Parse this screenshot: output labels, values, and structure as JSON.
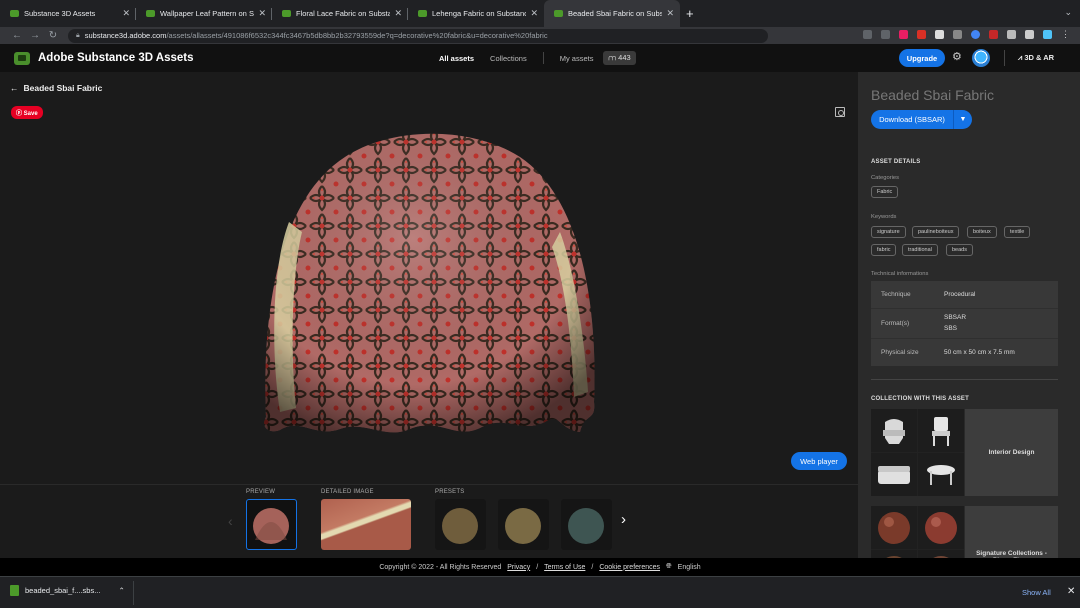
{
  "browser": {
    "tabs": [
      {
        "title": "Substance 3D Assets",
        "active": false
      },
      {
        "title": "Wallpaper Leaf Pattern on Sub",
        "active": false
      },
      {
        "title": "Floral Lace Fabric on Substanc",
        "active": false
      },
      {
        "title": "Lehenga Fabric on Substance",
        "active": false
      },
      {
        "title": "Beaded Sbai Fabric on Substa",
        "active": true
      }
    ],
    "new_tab": "+",
    "url_host": "substance3d.adobe.com",
    "url_path": "/assets/allassets/491086f6532c344fc3467b5db8bb2b32793559de?q=decorative%20fabric&u=decorative%20fabric"
  },
  "app": {
    "title": "Adobe Substance 3D Assets",
    "nav": {
      "all_assets": "All assets",
      "collections": "Collections",
      "my_assets": "My assets",
      "count": "443"
    },
    "upgrade": "Upgrade",
    "ar_link": "3D & AR"
  },
  "viewer": {
    "back_title": "Beaded Sbai Fabric",
    "save": "Save",
    "web_player": "Web player",
    "labels": {
      "preview": "PREVIEW",
      "detailed": "DETAILED IMAGE",
      "presets": "PRESETS"
    }
  },
  "panel": {
    "title": "Beaded Sbai Fabric",
    "download": "Download (SBSAR)",
    "asset_details": "ASSET DETAILS",
    "categories_label": "Categories",
    "categories": [
      "Fabric"
    ],
    "keywords_label": "Keywords",
    "keywords": [
      "signature",
      "paulineboiteux",
      "boiteux",
      "textile",
      "fabric",
      "traditional",
      "beads"
    ],
    "tech_label": "Technical informations",
    "technique_k": "Technique",
    "technique_v": "Procedural",
    "format_k": "Format(s)",
    "format_v1": "SBSAR",
    "format_v2": "SBS",
    "size_k": "Physical size",
    "size_v": "50 cm x 50 cm x 7.5 mm",
    "collection_head": "COLLECTION WITH THIS ASSET",
    "collections": [
      "Interior Design",
      "Signature Collections - Pierre Fleau"
    ]
  },
  "footer": {
    "copyright": "Copyright © 2022 - All Rights Reserved",
    "privacy": "Privacy",
    "terms": "Terms of Use",
    "cookies": "Cookie preferences",
    "language": "English"
  },
  "downloads": {
    "file": "beaded_sbai_f....sbs...",
    "show_all": "Show All"
  },
  "colors": {
    "accent": "#1473e6",
    "save_red": "#e60023",
    "brand_green": "#4a8f2c"
  }
}
